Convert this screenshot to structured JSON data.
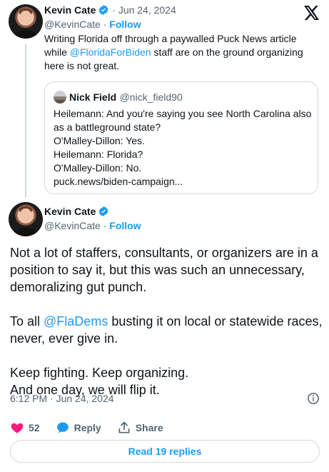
{
  "colors": {
    "link": "#1d9bf0",
    "like": "#f91880",
    "text": "#0f1419",
    "muted": "#536471",
    "border": "#cfd9de"
  },
  "reply_tweet": {
    "author_name": "Kevin Cate",
    "handle": "@KevinCate",
    "date": "Jun 24, 2024",
    "follow_label": "Follow",
    "text_before": "Writing Florida off through a paywalled Puck News article while ",
    "mention": "@FloridaForBiden",
    "text_after": " staff are on the ground organizing here is not great.",
    "quoted": {
      "author_name": "Nick Field",
      "handle": "@nick_field90",
      "lines": [
        "Heilemann: And you're saying you see North Carolina also",
        "as a battleground state?",
        "O'Malley-Dillon: Yes.",
        "Heilemann: Florida?",
        "O'Malley-Dillon: No.",
        "puck.news/biden-campaign..."
      ]
    }
  },
  "main_tweet": {
    "author_name": "Kevin Cate",
    "handle": "@KevinCate",
    "follow_label": "Follow",
    "paragraph1": "Not a lot of staffers, consultants, or organizers are in a position to say it, but this was such an unnecessary, demoralizing gut punch.",
    "paragraph2_prefix": "To all ",
    "paragraph2_mention": "@FlaDems",
    "paragraph2_suffix": " busting it on local or statewide races, never, ever give in.",
    "paragraph3_line1": "Keep fighting. Keep organizing.",
    "paragraph3_line2": "And one day, we will flip it.",
    "timestamp": "6:12 PM · Jun 24, 2024"
  },
  "actions": {
    "like_count": "52",
    "reply_label": "Reply",
    "share_label": "Share"
  },
  "read_replies_label": "Read 19 replies",
  "icons": [
    "x-logo-icon",
    "verified-badge-icon",
    "info-icon",
    "heart-icon",
    "reply-bubble-icon",
    "share-icon"
  ]
}
